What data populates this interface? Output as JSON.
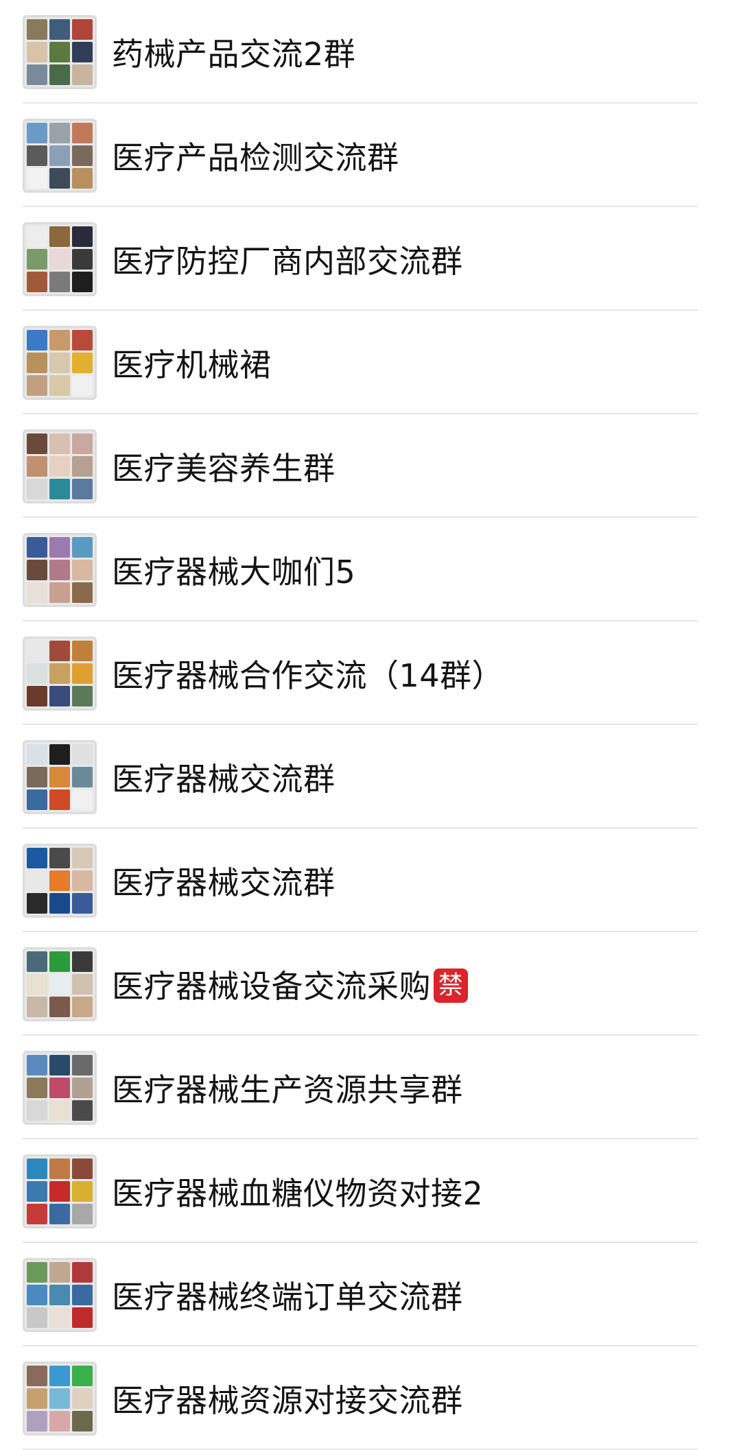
{
  "groups": [
    {
      "name": "药械产品交流2群",
      "tiles": [
        "#8a7a5c",
        "#3f5c7a",
        "#b0453a",
        "#d8c2a8",
        "#5c7a3f",
        "#2f3d5a",
        "#7a8a9a",
        "#4a6a4a",
        "#c8b4a0"
      ]
    },
    {
      "name": "医疗产品检测交流群",
      "tiles": [
        "#6a9ac8",
        "#9aa2aa",
        "#c07a5a",
        "#5a5a5a",
        "#8aa0b8",
        "#7a6a5a",
        "#f2f2f2",
        "#3c4a5a",
        "#b89060"
      ]
    },
    {
      "name": "医疗防控厂商内部交流群",
      "tiles": [
        "#ededed",
        "#8a6a3a",
        "#2a2a3a",
        "#7a9a6a",
        "#e8d8d8",
        "#3a3a3a",
        "#a05a3a",
        "#7a7a7a",
        "#1e1e1e"
      ]
    },
    {
      "name": "医疗机械裙",
      "tiles": [
        "#3a7ac8",
        "#c89a6a",
        "#b84a3a",
        "#b8905a",
        "#d8c8b0",
        "#e0b030",
        "#c0a080",
        "#d8c8a8",
        "#f0f0f0"
      ]
    },
    {
      "name": "医疗美容养生群",
      "tiles": [
        "#6a4a3a",
        "#d8c0b0",
        "#c8a8a0",
        "#c09070",
        "#e8d0c0",
        "#b8a090",
        "#d8d8d8",
        "#2a8a9a",
        "#5a7aa0"
      ]
    },
    {
      "name": "医疗器械大咖们5",
      "tiles": [
        "#3a5a9a",
        "#9a7ab0",
        "#5a9ac0",
        "#6a4a3a",
        "#b07a8a",
        "#d8b8a0",
        "#e8e0d8",
        "#c8a090",
        "#8a6a4a"
      ]
    },
    {
      "name": "医疗器械合作交流（14群）",
      "tiles": [
        "#e8e8e8",
        "#a04a3a",
        "#c0803a",
        "#d8e0e0",
        "#c8a060",
        "#e0a030",
        "#6a3a2a",
        "#3a4a7a",
        "#5a7a5a"
      ]
    },
    {
      "name": "医疗器械交流群",
      "tiles": [
        "#d8e0e8",
        "#1e1e1e",
        "#e0e0e0",
        "#7a6a5a",
        "#d88a3a",
        "#6a8a9a",
        "#3a6aa0",
        "#d04a2a",
        "#f0f0f0"
      ]
    },
    {
      "name": "医疗器械交流群",
      "tiles": [
        "#1a5aa0",
        "#4a4a4a",
        "#d8c8b8",
        "#e8e8e8",
        "#e87a2a",
        "#d8b8a0",
        "#2a2a2a",
        "#1a4a8a",
        "#3a5a9a"
      ]
    },
    {
      "name": "医疗器械设备交流采购",
      "badge": "禁",
      "tiles": [
        "#4a6a7a",
        "#2a9a3a",
        "#3a3a3a",
        "#e8e0d0",
        "#e8eef0",
        "#d0c0b0",
        "#c8b8a8",
        "#7a5a4a",
        "#c8a888"
      ]
    },
    {
      "name": "医疗器械生产资源共享群",
      "tiles": [
        "#5a8ac0",
        "#2a4a6a",
        "#6a6a6a",
        "#8a7a5a",
        "#c04a6a",
        "#b0a090",
        "#d8d8d8",
        "#e8e0d0",
        "#4a4a4a"
      ]
    },
    {
      "name": "医疗器械血糖仪物资对接2",
      "tiles": [
        "#2a8ac0",
        "#c07a4a",
        "#8a4a3a",
        "#3a7ab0",
        "#c82a2a",
        "#d8b030",
        "#c83a3a",
        "#3a6aa0",
        "#a8a8a8"
      ]
    },
    {
      "name": "医疗器械终端订单交流群",
      "tiles": [
        "#6a9a5a",
        "#c0a890",
        "#b03a3a",
        "#4a8ac0",
        "#4a8ab0",
        "#3a6aa0",
        "#c8c8c8",
        "#e8e0d8",
        "#c02a2a"
      ]
    },
    {
      "name": "医疗器械资源对接交流群",
      "tiles": [
        "#8a6a5a",
        "#3a9ad0",
        "#3ab04a",
        "#c8a070",
        "#7ab8d8",
        "#e0d0c0",
        "#b0a0c0",
        "#d8a8a8",
        "#6a6a4a"
      ]
    }
  ]
}
